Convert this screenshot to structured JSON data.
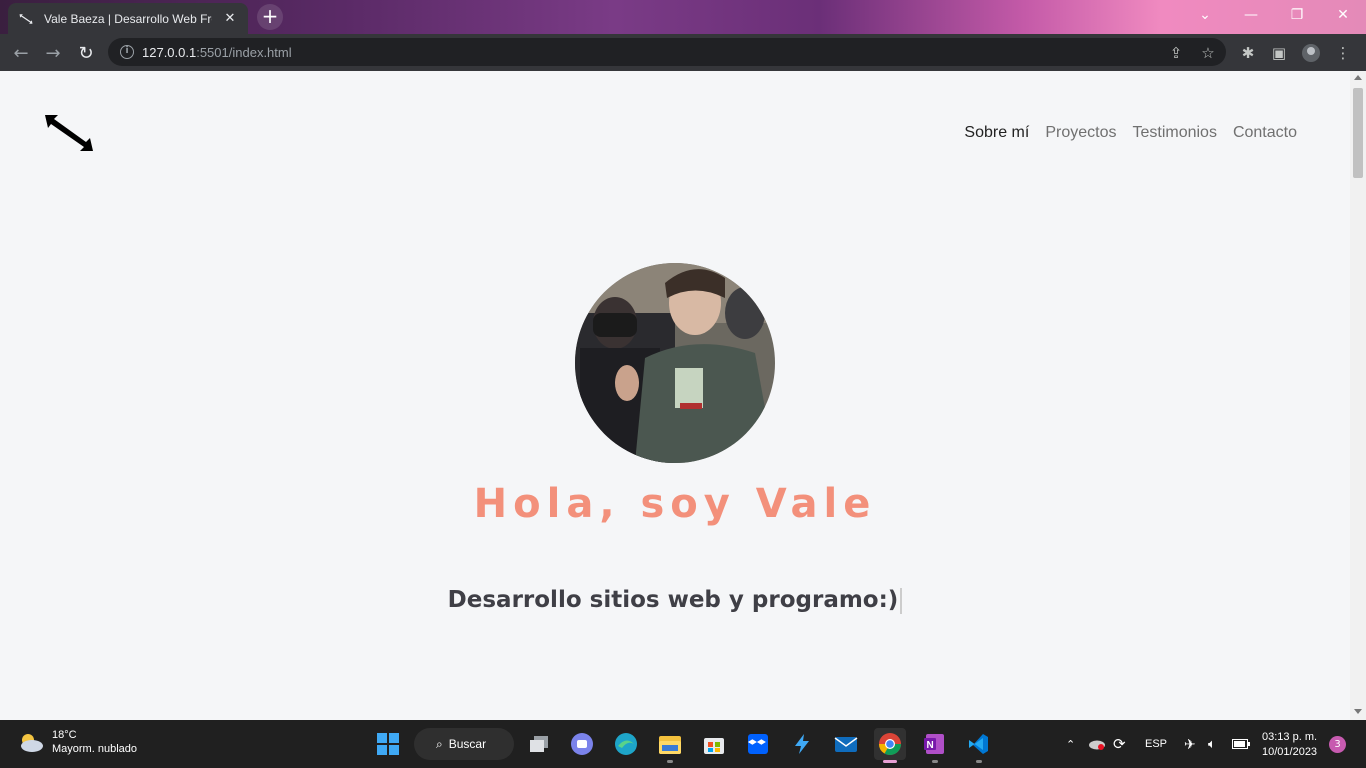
{
  "browser": {
    "tab_title": "Vale Baeza | Desarrollo Web Fron",
    "url_host": "127.0.0.1",
    "url_rest": ":5501/index.html"
  },
  "page": {
    "nav": [
      {
        "label": "Sobre mí",
        "active": true
      },
      {
        "label": "Proyectos",
        "active": false
      },
      {
        "label": "Testimonios",
        "active": false
      },
      {
        "label": "Contacto",
        "active": false
      }
    ],
    "hero_title": "Hola, soy Vale",
    "hero_subtitle": "Desarrollo sitios web y programo:)",
    "accent_color": "#f3907b"
  },
  "taskbar": {
    "weather_temp": "18°C",
    "weather_desc": "Mayorm. nublado",
    "search_label": "Buscar",
    "lang": "ESP",
    "time": "03:13 p. m.",
    "date": "10/01/2023",
    "notifications": "3"
  },
  "icons": [
    "logo-icon",
    "back-icon",
    "forward-icon",
    "reload-icon",
    "info-icon",
    "share-icon",
    "star-icon",
    "extensions-icon",
    "sidepanel-icon",
    "profile-icon",
    "menu-icon"
  ]
}
